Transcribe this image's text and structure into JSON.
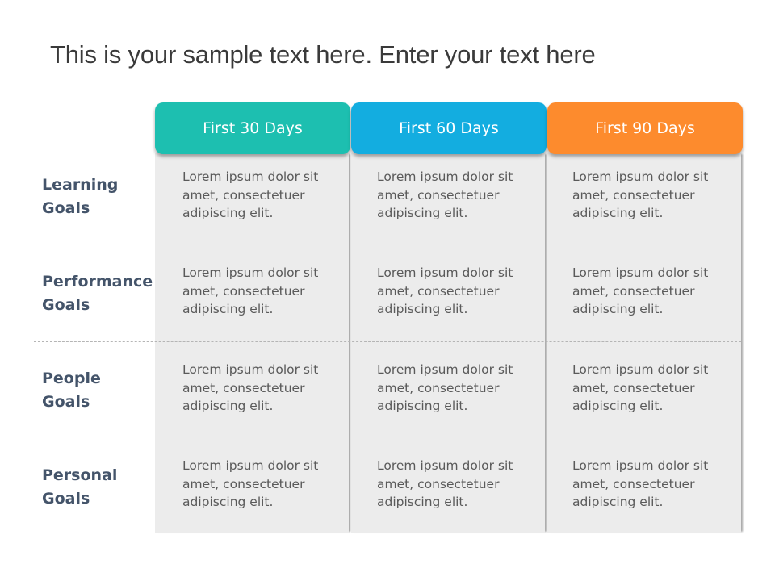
{
  "title": "This is your sample text here. Enter your text here",
  "columns": [
    {
      "label": "First 30 Days",
      "color": "#1dbfb0"
    },
    {
      "label": "First 60 Days",
      "color": "#13ade0"
    },
    {
      "label": "First 90 Days",
      "color": "#fd8b2d"
    }
  ],
  "rows": [
    {
      "label_line1": "Learning",
      "label_line2": "Goals",
      "cells": [
        {
          "l1": "Lorem ipsum dolor sit",
          "l2": "amet, consectetuer",
          "l3": "adipiscing elit."
        },
        {
          "l1": "Lorem ipsum dolor sit",
          "l2": "amet, consectetuer",
          "l3": "adipiscing elit."
        },
        {
          "l1": "Lorem ipsum dolor sit",
          "l2": "amet, consectetuer",
          "l3": "adipiscing elit."
        }
      ]
    },
    {
      "label_line1": "Performance",
      "label_line2": "Goals",
      "cells": [
        {
          "l1": "Lorem ipsum dolor sit",
          "l2": "amet, consectetuer",
          "l3": "adipiscing elit."
        },
        {
          "l1": "Lorem ipsum dolor sit",
          "l2": "amet, consectetuer",
          "l3": "adipiscing elit."
        },
        {
          "l1": "Lorem ipsum dolor sit",
          "l2": "amet, consectetuer",
          "l3": "adipiscing elit."
        }
      ]
    },
    {
      "label_line1": "People",
      "label_line2": "Goals",
      "cells": [
        {
          "l1": "Lorem ipsum dolor sit",
          "l2": "amet, consectetuer",
          "l3": "adipiscing elit."
        },
        {
          "l1": "Lorem ipsum dolor sit",
          "l2": "amet, consectetuer",
          "l3": "adipiscing elit."
        },
        {
          "l1": "Lorem ipsum dolor sit",
          "l2": "amet, consectetuer",
          "l3": "adipiscing elit."
        }
      ]
    },
    {
      "label_line1": "Personal",
      "label_line2": "Goals",
      "cells": [
        {
          "l1": "Lorem ipsum dolor sit",
          "l2": "amet, consectetuer",
          "l3": "adipiscing elit."
        },
        {
          "l1": "Lorem ipsum dolor sit",
          "l2": "amet, consectetuer",
          "l3": "adipiscing elit."
        },
        {
          "l1": "Lorem ipsum dolor sit",
          "l2": "amet, consectetuer",
          "l3": "adipiscing elit."
        }
      ]
    }
  ]
}
